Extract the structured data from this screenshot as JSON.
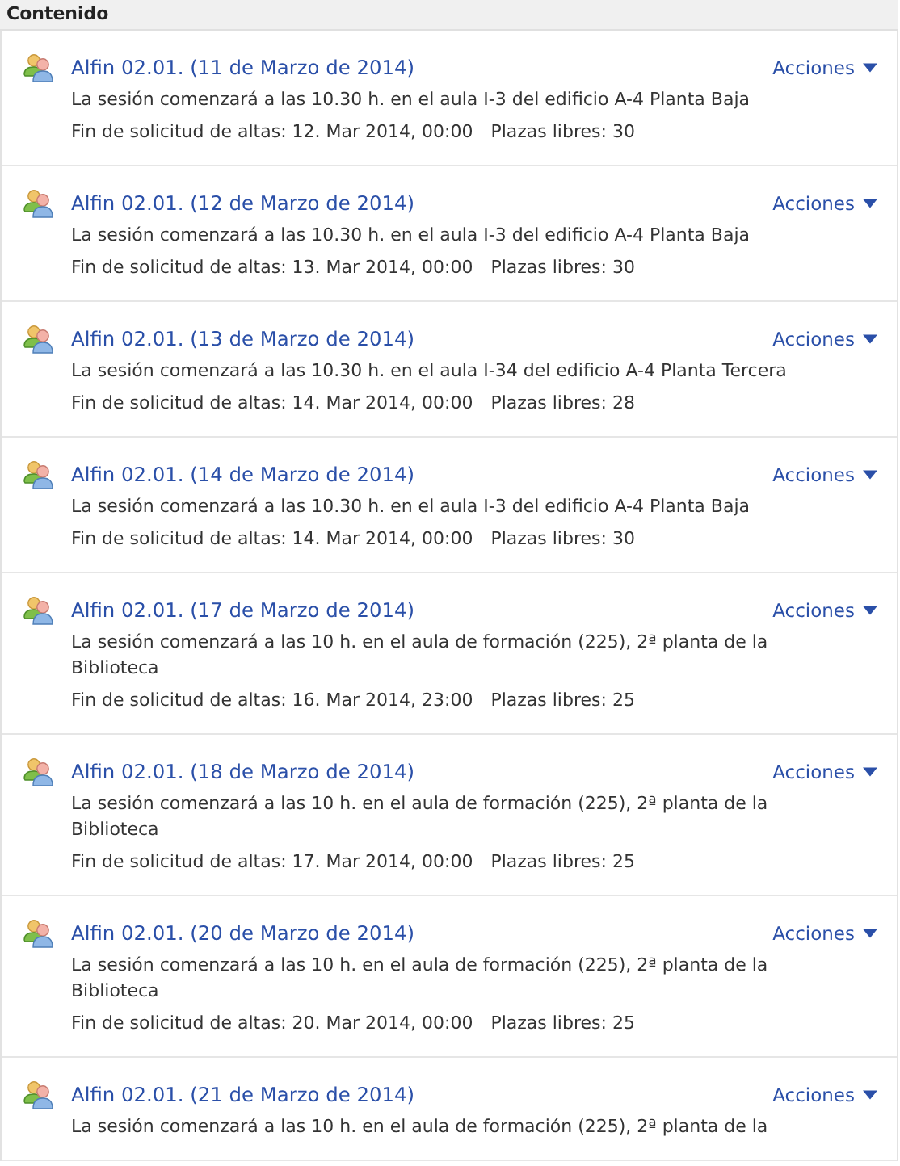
{
  "header": {
    "title": "Contenido"
  },
  "sessions": [
    {
      "title": "Alfin 02.01. (11 de Marzo de 2014)",
      "actions": "Acciones",
      "description": "La sesión comenzará a las 10.30 h. en el aula I-3 del edificio A-4 Planta Baja",
      "deadline": "Fin de solicitud de altas: 12. Mar 2014, 00:00",
      "seats": "Plazas libres: 30"
    },
    {
      "title": "Alfin 02.01. (12 de Marzo de 2014)",
      "actions": "Acciones",
      "description": "La sesión comenzará a las 10.30 h. en el aula I-3 del edificio A-4 Planta Baja",
      "deadline": "Fin de solicitud de altas: 13. Mar 2014, 00:00",
      "seats": "Plazas libres: 30"
    },
    {
      "title": "Alfin 02.01. (13 de Marzo de 2014)",
      "actions": "Acciones",
      "description": "La sesión comenzará a las 10.30 h. en el aula I-34 del edificio A-4 Planta Tercera",
      "deadline": "Fin de solicitud de altas: 14. Mar 2014, 00:00",
      "seats": "Plazas libres: 28"
    },
    {
      "title": "Alfin 02.01. (14 de Marzo de 2014)",
      "actions": "Acciones",
      "description": "La sesión comenzará a las 10.30 h. en el aula I-3 del edificio A-4 Planta Baja",
      "deadline": "Fin de solicitud de altas: 14. Mar 2014, 00:00",
      "seats": "Plazas libres: 30"
    },
    {
      "title": "Alfin 02.01. (17 de Marzo de 2014)",
      "actions": "Acciones",
      "description": "La sesión comenzará a las 10 h. en el aula de formación (225), 2ª planta de la Biblioteca",
      "deadline": "Fin de solicitud de altas: 16. Mar 2014, 23:00",
      "seats": "Plazas libres: 25"
    },
    {
      "title": "Alfin 02.01. (18 de Marzo de 2014)",
      "actions": "Acciones",
      "description": "La sesión comenzará a las 10 h. en el aula de formación (225), 2ª planta de la Biblioteca",
      "deadline": "Fin de solicitud de altas: 17. Mar 2014, 00:00",
      "seats": "Plazas libres: 25"
    },
    {
      "title": "Alfin 02.01. (20 de Marzo de 2014)",
      "actions": "Acciones",
      "description": "La sesión comenzará a las 10 h. en el aula de formación (225), 2ª planta de la Biblioteca",
      "deadline": "Fin de solicitud de altas: 20. Mar 2014, 00:00",
      "seats": "Plazas libres: 25"
    },
    {
      "title": "Alfin 02.01. (21 de Marzo de 2014)",
      "actions": "Acciones",
      "description": "La sesión comenzará a las 10 h. en el aula de formación (225), 2ª planta de la"
    }
  ]
}
